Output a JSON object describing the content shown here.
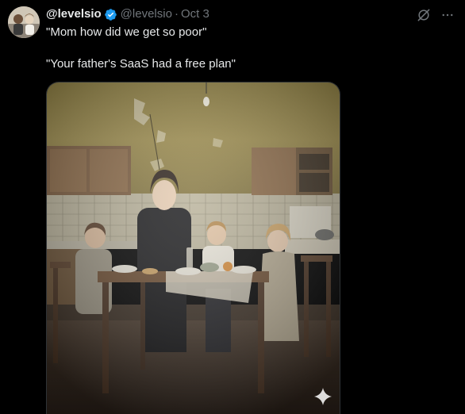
{
  "tweet": {
    "display_name": "@levelsio",
    "handle": "@levelsio",
    "separator": "·",
    "date": "Oct 3",
    "text_line1": "\"Mom how did we get so poor\"",
    "text_line2": "\"Your father's SaaS had a free plan\""
  },
  "icons": {
    "verified": "verified-badge-icon",
    "grok": "grok-icon",
    "more": "more-options-icon",
    "sparkle": "ai-sparkle-icon"
  },
  "colors": {
    "background": "#000000",
    "text": "#e7e9ea",
    "secondary": "#71767b",
    "verified": "#1d9bf0"
  }
}
